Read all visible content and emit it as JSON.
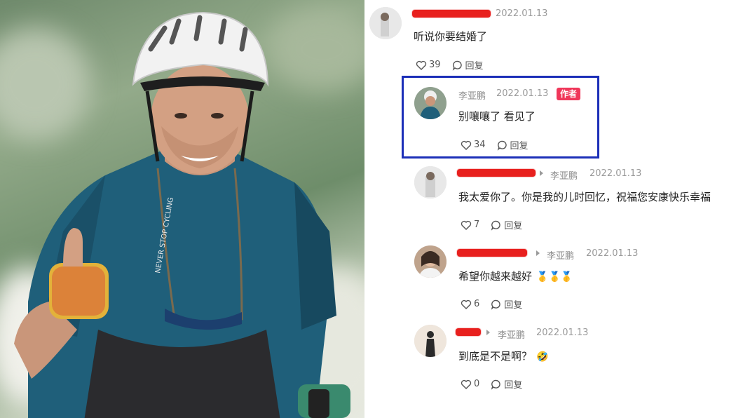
{
  "comments": [
    {
      "date": "2022.01.13",
      "text": "听说你要结婚了",
      "likes": "39",
      "reply_label": "回复"
    },
    {
      "name": "李亚鹏",
      "date": "2022.01.13",
      "badge": "作者",
      "text": "别嚷嚷了 看见了",
      "likes": "34",
      "reply_label": "回复"
    },
    {
      "reply_to": "李亚鹏",
      "date": "2022.01.13",
      "text": "我太爱你了。你是我的儿时回忆，祝福您安康快乐幸福",
      "likes": "7",
      "reply_label": "回复"
    },
    {
      "reply_to": "李亚鹏",
      "date": "2022.01.13",
      "text": "希望你越来越好",
      "emoji": "🥇🥇🥇",
      "likes": "6",
      "reply_label": "回复"
    },
    {
      "reply_to": "李亚鹏",
      "date": "2022.01.13",
      "text": "到底是不是啊？",
      "emoji": "🤣",
      "likes": "0",
      "reply_label": "回复"
    }
  ],
  "icons": {
    "like": "heart-outline-icon",
    "reply": "speech-bubble-icon"
  },
  "colors": {
    "redaction": "#e8201e",
    "author_badge": "#f0375a",
    "highlight_box": "#1c2fb8"
  }
}
